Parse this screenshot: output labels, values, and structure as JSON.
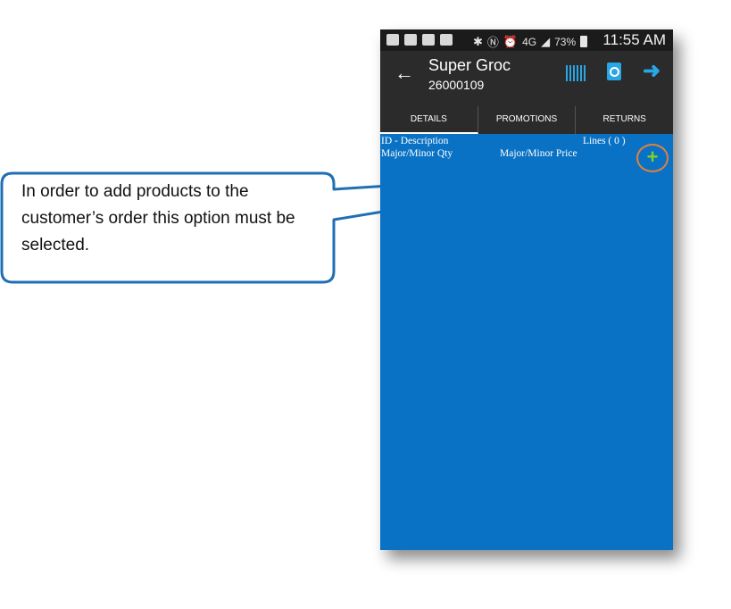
{
  "status_bar": {
    "battery": "73%",
    "network": "4G",
    "time": "11:55 AM"
  },
  "app_bar": {
    "title": "Super Groc",
    "subtitle": "26000109",
    "icons": [
      "back-arrow-icon",
      "barcode-icon",
      "search-document-icon",
      "forward-arrow-icon"
    ]
  },
  "tabs": [
    {
      "label": "DETAILS",
      "active": true
    },
    {
      "label": "PROMOTIONS",
      "active": false
    },
    {
      "label": "RETURNS",
      "active": false
    }
  ],
  "list_header": {
    "id_description": "ID - Description",
    "lines": "Lines ( 0 )",
    "qty": "Major/Minor Qty",
    "price": "Major/Minor Price",
    "add_symbol": "+"
  },
  "callout": {
    "text": "In order to add products to the customer’s order this option must be selected."
  },
  "colors": {
    "content_blue": "#0a72c4",
    "accent_blue": "#29a6e6",
    "add_green": "#7fd12a",
    "highlight_orange": "#e08040",
    "callout_border": "#1f6fb5"
  }
}
